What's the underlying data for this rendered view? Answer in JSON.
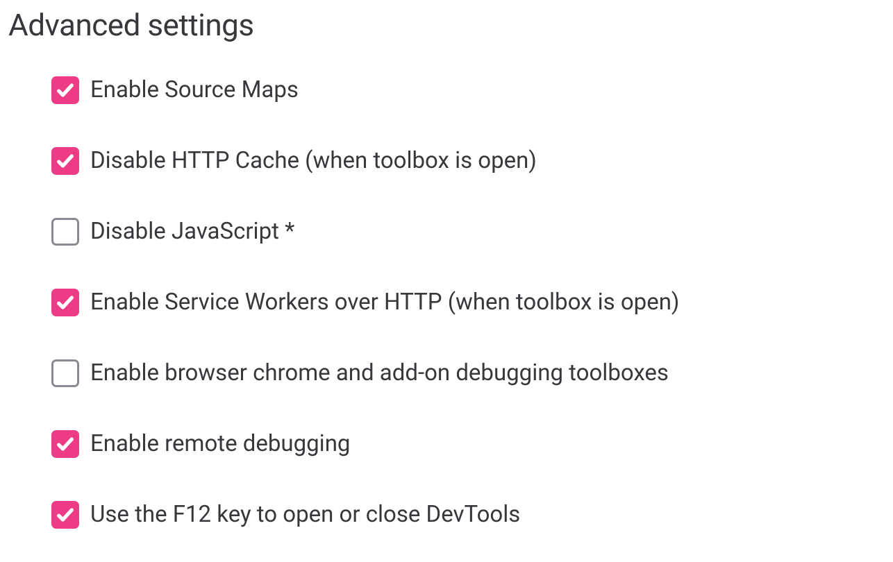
{
  "section": {
    "title": "Advanced settings",
    "options": [
      {
        "id": "enable-source-maps",
        "label": "Enable Source Maps",
        "checked": true
      },
      {
        "id": "disable-http-cache",
        "label": "Disable HTTP Cache (when toolbox is open)",
        "checked": true
      },
      {
        "id": "disable-javascript",
        "label": "Disable JavaScript *",
        "checked": false
      },
      {
        "id": "enable-service-workers-http",
        "label": "Enable Service Workers over HTTP (when toolbox is open)",
        "checked": true
      },
      {
        "id": "enable-browser-chrome-debugging",
        "label": "Enable browser chrome and add-on debugging toolboxes",
        "checked": false
      },
      {
        "id": "enable-remote-debugging",
        "label": "Enable remote debugging",
        "checked": true
      },
      {
        "id": "use-f12-key",
        "label": "Use the F12 key to open or close DevTools",
        "checked": true
      }
    ]
  },
  "colors": {
    "accent": "#ed3b86",
    "text": "#36383b",
    "checkbox_border": "#8a8a93"
  }
}
